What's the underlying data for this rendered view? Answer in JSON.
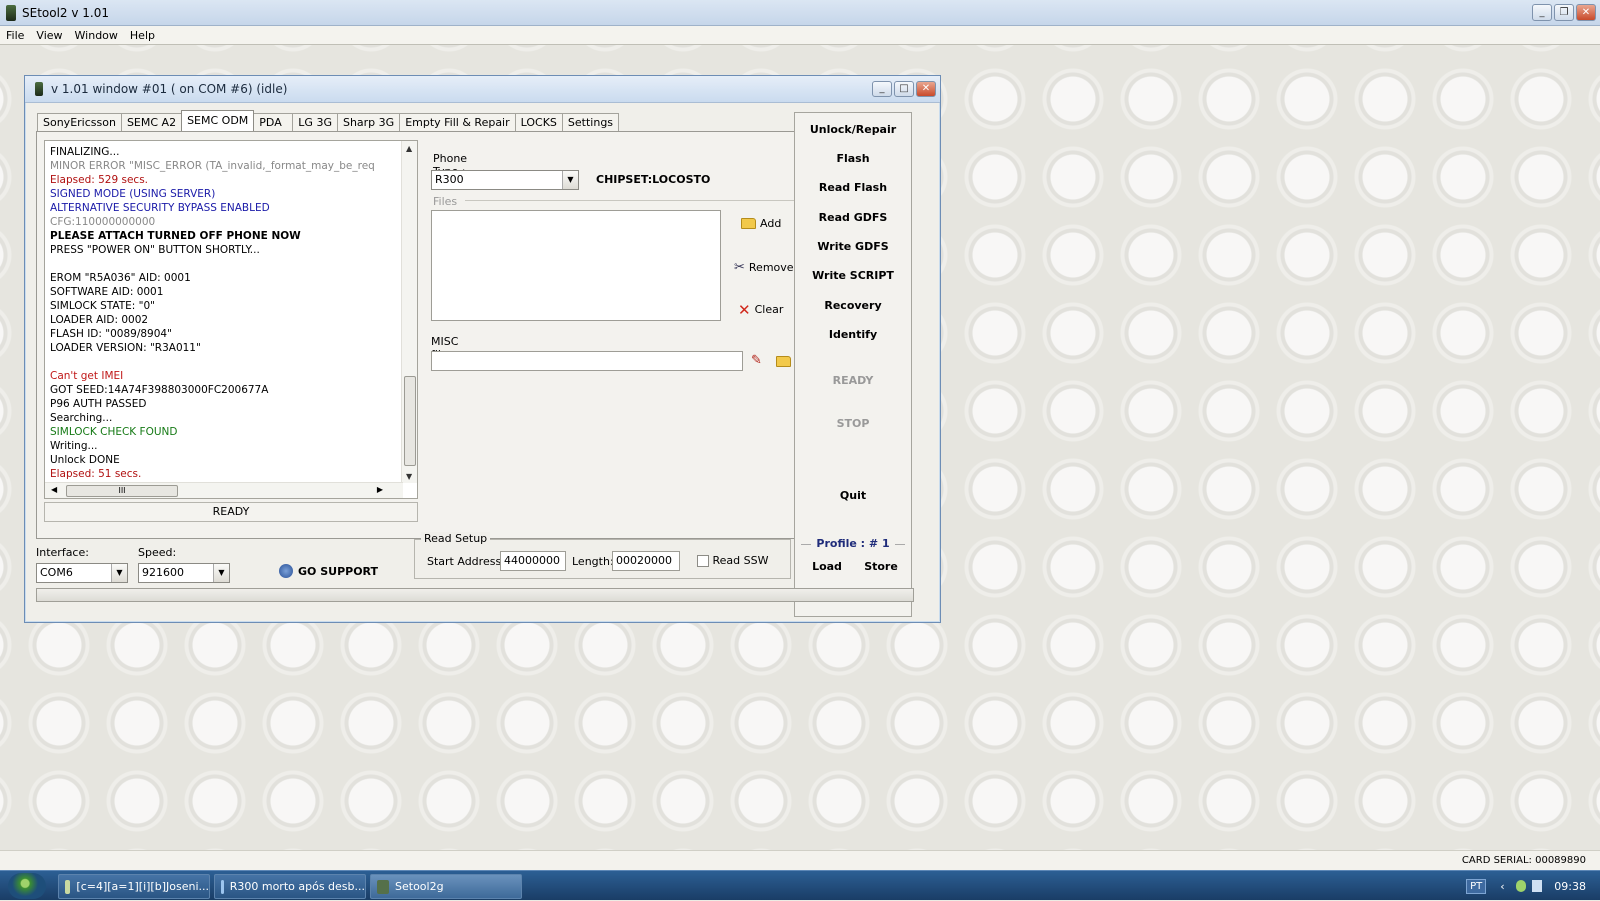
{
  "app": {
    "title": "SEtool2 v 1.01"
  },
  "menu": [
    "File",
    "View",
    "Window",
    "Help"
  ],
  "window": {
    "title": "v 1.01 window #01 ( on COM #6) (idle)"
  },
  "tabs": [
    "SonyEricsson",
    "SEMC A2",
    "SEMC ODM",
    "PDA",
    "LG 3G",
    "Sharp 3G",
    "Empty Fill & Repair",
    "LOCKS",
    "Settings"
  ],
  "active_tab": "SEMC ODM",
  "log": [
    {
      "t": "FINALIZING...",
      "c": "#000"
    },
    {
      "t": "MINOR ERROR \"MISC_ERROR (TA_invalid,_format_may_be_req",
      "c": "#888"
    },
    {
      "t": "Elapsed: 529 secs.",
      "c": "#b01010"
    },
    {
      "t": "SIGNED MODE (USING SERVER)",
      "c": "#1a1aa8"
    },
    {
      "t": "ALTERNATIVE SECURITY BYPASS ENABLED",
      "c": "#1a1aa8"
    },
    {
      "t": "CFG:110000000000",
      "c": "#888"
    },
    {
      "t": "PLEASE ATTACH TURNED OFF PHONE NOW",
      "c": "#000",
      "b": true
    },
    {
      "t": "PRESS \"POWER ON\" BUTTON SHORTLY...",
      "c": "#000"
    },
    {
      "t": "",
      "c": "#000"
    },
    {
      "t": "EROM \"R5A036\" AID: 0001",
      "c": "#000"
    },
    {
      "t": "SOFTWARE AID: 0001",
      "c": "#000"
    },
    {
      "t": "SIMLOCK STATE: \"0\"",
      "c": "#000"
    },
    {
      "t": "LOADER AID: 0002",
      "c": "#000"
    },
    {
      "t": "FLASH ID: \"0089/8904\"",
      "c": "#000"
    },
    {
      "t": "LOADER VERSION: \"R3A011\"",
      "c": "#000"
    },
    {
      "t": "",
      "c": "#000"
    },
    {
      "t": "Can't get IMEI",
      "c": "#c01818"
    },
    {
      "t": "GOT SEED:14A74F398803000FC200677A",
      "c": "#000"
    },
    {
      "t": "P96 AUTH PASSED",
      "c": "#000"
    },
    {
      "t": "Searching...",
      "c": "#000"
    },
    {
      "t": "SIMLOCK CHECK FOUND",
      "c": "#167a16"
    },
    {
      "t": "Writing...",
      "c": "#000"
    },
    {
      "t": "Unlock DONE",
      "c": "#000"
    },
    {
      "t": "Elapsed: 51 secs.",
      "c": "#b01010"
    }
  ],
  "log_status": "READY",
  "phone_type": {
    "label": "Phone Type :",
    "value": "R300"
  },
  "chipset": "CHIPSET:LOCOSTO",
  "files": {
    "label": "Files :",
    "add": "Add",
    "remove": "Remove",
    "clear": "Clear"
  },
  "misc_files": {
    "label": "MISC files:",
    "value": ""
  },
  "actions": [
    "Unlock/Repair",
    "Flash",
    "Read Flash",
    "Read GDFS",
    "Write GDFS",
    "Write SCRIPT",
    "Recovery",
    "Identify"
  ],
  "state": {
    "ready": "READY",
    "stop": "STOP",
    "quit": "Quit"
  },
  "profile": {
    "label": "Profile :  # 1",
    "load": "Load",
    "store": "Store"
  },
  "interface": {
    "label": "Interface:",
    "value": "COM6"
  },
  "speed": {
    "label": "Speed:",
    "value": "921600"
  },
  "go_support": "GO SUPPORT",
  "read_setup": {
    "legend": "Read Setup",
    "start_label": "Start Address:",
    "start_value": "44000000",
    "length_label": "Length:",
    "length_value": "00020000",
    "read_ssw_label": "Read SSW",
    "read_ssw_checked": false
  },
  "card_serial": "CARD SERIAL: 00089890",
  "taskbar": {
    "items": [
      "[c=4][a=1][i][b]Joseni...",
      "R300 morto após desb...",
      "Setool2g"
    ],
    "lang": "PT",
    "clock": "09:38"
  }
}
